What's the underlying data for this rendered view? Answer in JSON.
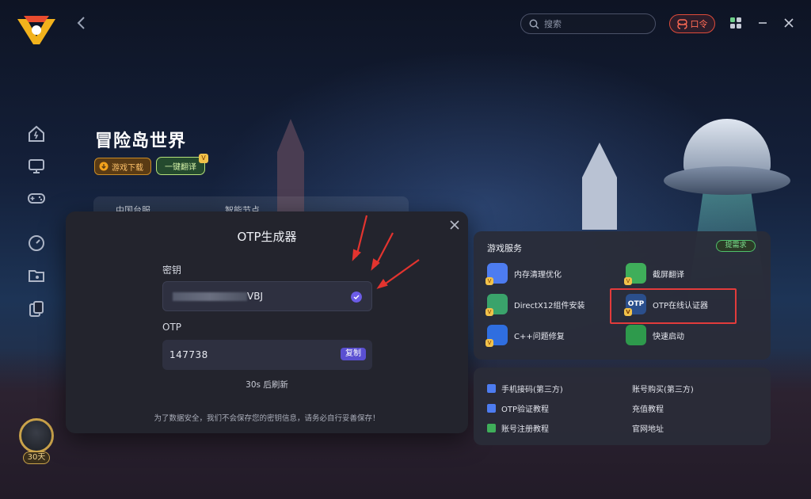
{
  "topbar": {
    "search_placeholder": "搜索",
    "command_label": "口令"
  },
  "game": {
    "title": "冒险岛世界",
    "download_label": "游戏下载",
    "translate_label": "一键翻译",
    "server_label": "中国台服",
    "node_label": "智能节点"
  },
  "user": {
    "days": "30天"
  },
  "otp_dialog": {
    "title": "OTP生成器",
    "key_label": "密钥",
    "key_visible_suffix": "VBJ",
    "otp_label": "OTP",
    "otp_value": "147738",
    "copy_label": "复制",
    "refresh_text": "30s 后刷新",
    "notice_text": "为了数据安全，我们不会保存您的密钥信息，请务必自行妥善保存！"
  },
  "services": {
    "title": "游戏服务",
    "request_label": "提需求",
    "items": [
      {
        "label": "内存清理优化",
        "icon": "memory-icon",
        "color": "#4d7cf0"
      },
      {
        "label": "截屏翻译",
        "icon": "screenshot-translate-icon",
        "color": "#3fae5a"
      },
      {
        "label": "DirectX12组件安装",
        "icon": "directx-icon",
        "color": "#3aa36b"
      },
      {
        "label": "OTP在线认证器",
        "icon": "otp-icon",
        "color": "#2b4f8c"
      },
      {
        "label": "C++问题修复",
        "icon": "cpp-fix-icon",
        "color": "#2f6ee0"
      },
      {
        "label": "快速启动",
        "icon": "quick-start-icon",
        "color": "#2e9a4c"
      }
    ],
    "links": [
      {
        "label": "手机接码(第三方)",
        "color": "#4d7cf0"
      },
      {
        "label": "账号购买(第三方)",
        "color": ""
      },
      {
        "label": "OTP验证教程",
        "color": "#4d7cf0"
      },
      {
        "label": "充值教程",
        "color": ""
      },
      {
        "label": "账号注册教程",
        "color": "#3fae5a"
      },
      {
        "label": "官网地址",
        "color": ""
      }
    ]
  },
  "colors": {
    "accent_purple": "#5a4fd1",
    "highlight_red": "#e23b3b",
    "command_red": "#e04b3a"
  }
}
